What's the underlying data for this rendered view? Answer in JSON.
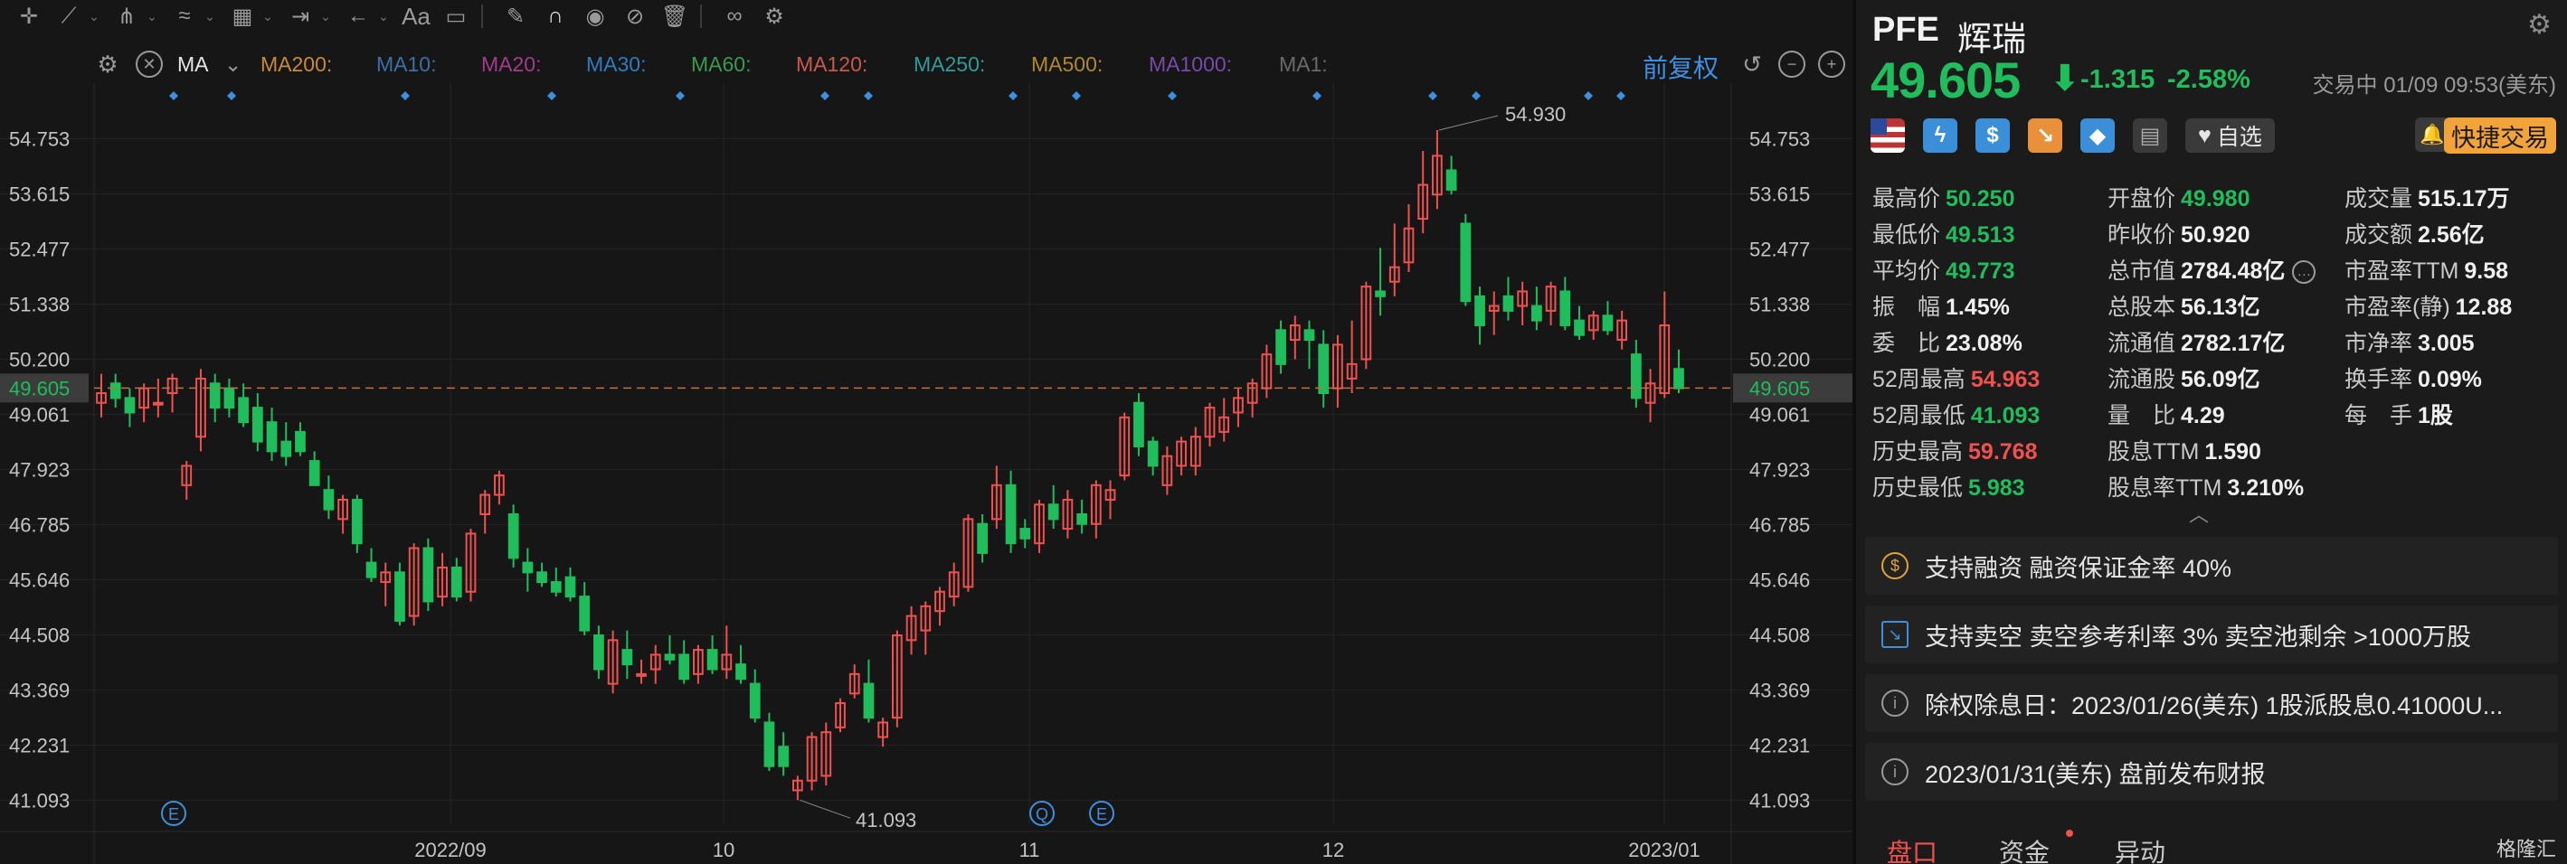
{
  "toolbar": {
    "icons": [
      "crosshair-icon",
      "line-tool-icon",
      "pitchfork-icon",
      "wave-icon",
      "fibonacci-icon",
      "measure-icon",
      "arrow-icon",
      "text-icon",
      "comment-icon",
      "pen-icon",
      "magnet-icon",
      "eye-icon",
      "hide-icon",
      "trash-icon",
      "link-icon",
      "gear-icon"
    ],
    "text_tool": "Aa"
  },
  "indicator_bar": {
    "selected": "MA",
    "items": [
      {
        "label": "MA200:",
        "color": "#c9883b"
      },
      {
        "label": "MA10:",
        "color": "#3b6fa6"
      },
      {
        "label": "MA20:",
        "color": "#a23b8c"
      },
      {
        "label": "MA30:",
        "color": "#2f7bbf"
      },
      {
        "label": "MA60:",
        "color": "#3a9a4e"
      },
      {
        "label": "MA120:",
        "color": "#c95a4a"
      },
      {
        "label": "MA250:",
        "color": "#2f9b9b"
      },
      {
        "label": "MA500:",
        "color": "#b08a2a"
      },
      {
        "label": "MA1000:",
        "color": "#7a4aa8"
      },
      {
        "label": "MA1:",
        "color": "#6a6a6a"
      }
    ],
    "adjust_label": "前复权"
  },
  "chart_data": {
    "type": "candlestick",
    "y_ticks": [
      "54.753",
      "53.615",
      "52.477",
      "51.338",
      "50.200",
      "49.061",
      "47.923",
      "46.785",
      "45.646",
      "44.508",
      "43.369",
      "42.231",
      "41.093"
    ],
    "ylim": [
      40.6,
      55.9
    ],
    "x_ticks": [
      "2022/09",
      "10",
      "11",
      "12",
      "2023/01"
    ],
    "current_price": 49.605,
    "annotations": [
      {
        "label": "54.930",
        "value": 54.93
      },
      {
        "label": "41.093",
        "value": 41.093
      }
    ],
    "event_markers": [
      "E",
      "Q",
      "E"
    ],
    "colors": {
      "up": "#f0514f",
      "down": "#1fbd5b",
      "current_line": "#c7703a",
      "current_label_bg": "#3c3c3c"
    },
    "candles": [
      [
        49.3,
        49.9,
        49.0,
        49.5
      ],
      [
        49.7,
        49.9,
        49.2,
        49.4
      ],
      [
        49.4,
        49.6,
        48.8,
        49.1
      ],
      [
        49.2,
        49.7,
        48.9,
        49.6
      ],
      [
        49.3,
        49.8,
        49.0,
        49.3
      ],
      [
        49.5,
        49.9,
        49.1,
        49.8
      ],
      [
        47.6,
        48.1,
        47.3,
        48.0
      ],
      [
        48.6,
        50.0,
        48.3,
        49.8
      ],
      [
        49.7,
        49.9,
        48.9,
        49.2
      ],
      [
        49.6,
        49.8,
        49.0,
        49.2
      ],
      [
        49.4,
        49.7,
        48.8,
        48.9
      ],
      [
        49.2,
        49.5,
        48.3,
        48.5
      ],
      [
        48.9,
        49.2,
        48.1,
        48.3
      ],
      [
        48.5,
        48.9,
        48.0,
        48.2
      ],
      [
        48.7,
        48.9,
        48.2,
        48.3
      ],
      [
        48.1,
        48.3,
        47.6,
        47.6
      ],
      [
        47.5,
        47.8,
        46.9,
        47.1
      ],
      [
        46.9,
        47.4,
        46.6,
        47.3
      ],
      [
        47.3,
        47.4,
        46.2,
        46.4
      ],
      [
        46.0,
        46.3,
        45.6,
        45.7
      ],
      [
        45.6,
        46.0,
        45.1,
        45.8
      ],
      [
        45.8,
        46.0,
        44.7,
        44.8
      ],
      [
        44.9,
        46.4,
        44.7,
        46.3
      ],
      [
        46.3,
        46.5,
        45.0,
        45.2
      ],
      [
        45.3,
        46.2,
        45.1,
        45.9
      ],
      [
        45.9,
        46.1,
        45.2,
        45.3
      ],
      [
        45.4,
        46.7,
        45.2,
        46.6
      ],
      [
        47.0,
        47.5,
        46.6,
        47.4
      ],
      [
        47.4,
        47.9,
        47.2,
        47.8
      ],
      [
        47.0,
        47.2,
        45.9,
        46.1
      ],
      [
        46.0,
        46.3,
        45.4,
        45.8
      ],
      [
        45.8,
        46.0,
        45.5,
        45.6
      ],
      [
        45.6,
        45.9,
        45.3,
        45.4
      ],
      [
        45.7,
        45.9,
        45.2,
        45.3
      ],
      [
        45.3,
        45.6,
        44.5,
        44.6
      ],
      [
        44.5,
        44.7,
        43.6,
        43.8
      ],
      [
        43.5,
        44.6,
        43.3,
        44.4
      ],
      [
        44.2,
        44.6,
        43.6,
        43.9
      ],
      [
        43.7,
        44.0,
        43.5,
        43.7
      ],
      [
        43.8,
        44.3,
        43.5,
        44.1
      ],
      [
        44.1,
        44.5,
        43.9,
        44.0
      ],
      [
        44.1,
        44.4,
        43.5,
        43.6
      ],
      [
        43.7,
        44.3,
        43.5,
        44.2
      ],
      [
        44.2,
        44.5,
        43.7,
        43.8
      ],
      [
        43.8,
        44.7,
        43.6,
        44.1
      ],
      [
        43.9,
        44.3,
        43.5,
        43.6
      ],
      [
        43.5,
        43.8,
        42.7,
        42.8
      ],
      [
        42.7,
        42.9,
        41.7,
        41.8
      ],
      [
        42.2,
        42.5,
        41.6,
        41.8
      ],
      [
        41.3,
        41.6,
        41.1,
        41.5
      ],
      [
        41.5,
        42.5,
        41.3,
        42.4
      ],
      [
        41.6,
        42.7,
        41.4,
        42.5
      ],
      [
        42.6,
        43.2,
        42.5,
        43.1
      ],
      [
        43.3,
        43.9,
        43.2,
        43.7
      ],
      [
        43.5,
        44.0,
        42.7,
        42.8
      ],
      [
        42.4,
        42.8,
        42.2,
        42.7
      ],
      [
        42.8,
        44.6,
        42.6,
        44.5
      ],
      [
        44.4,
        45.1,
        44.1,
        44.9
      ],
      [
        44.6,
        45.2,
        44.1,
        45.1
      ],
      [
        45.0,
        45.5,
        44.7,
        45.4
      ],
      [
        45.3,
        46.0,
        45.1,
        45.8
      ],
      [
        45.5,
        47.0,
        45.4,
        46.9
      ],
      [
        46.8,
        47.0,
        46.0,
        46.2
      ],
      [
        46.9,
        48.0,
        46.7,
        47.6
      ],
      [
        47.6,
        47.9,
        46.2,
        46.4
      ],
      [
        46.7,
        46.9,
        46.3,
        46.5
      ],
      [
        46.4,
        47.3,
        46.2,
        47.2
      ],
      [
        47.2,
        47.6,
        46.7,
        46.9
      ],
      [
        46.7,
        47.5,
        46.5,
        47.3
      ],
      [
        47.0,
        47.3,
        46.6,
        46.8
      ],
      [
        46.8,
        47.7,
        46.5,
        47.6
      ],
      [
        47.3,
        47.7,
        46.9,
        47.5
      ],
      [
        47.8,
        49.1,
        47.7,
        49.0
      ],
      [
        49.3,
        49.5,
        48.2,
        48.4
      ],
      [
        48.5,
        48.6,
        47.8,
        48.0
      ],
      [
        47.6,
        48.4,
        47.4,
        48.2
      ],
      [
        48.0,
        48.6,
        47.8,
        48.5
      ],
      [
        48.0,
        48.8,
        47.8,
        48.6
      ],
      [
        48.6,
        49.3,
        48.4,
        49.2
      ],
      [
        48.7,
        49.4,
        48.5,
        49.0
      ],
      [
        49.1,
        49.6,
        48.8,
        49.4
      ],
      [
        49.3,
        49.8,
        49.0,
        49.7
      ],
      [
        49.6,
        50.5,
        49.4,
        50.3
      ],
      [
        50.8,
        51.0,
        49.9,
        50.1
      ],
      [
        50.6,
        51.1,
        50.2,
        50.9
      ],
      [
        50.8,
        51.0,
        50.0,
        50.6
      ],
      [
        50.5,
        50.8,
        49.2,
        49.5
      ],
      [
        49.6,
        50.7,
        49.2,
        50.5
      ],
      [
        49.8,
        51.0,
        49.5,
        50.1
      ],
      [
        50.2,
        51.8,
        50.0,
        51.7
      ],
      [
        51.6,
        52.5,
        51.1,
        51.5
      ],
      [
        51.8,
        53.0,
        51.5,
        52.1
      ],
      [
        52.2,
        53.4,
        52.0,
        52.9
      ],
      [
        53.1,
        54.5,
        52.8,
        53.8
      ],
      [
        53.6,
        54.93,
        53.3,
        54.4
      ],
      [
        54.1,
        54.4,
        53.6,
        53.7
      ],
      [
        53.0,
        53.2,
        51.3,
        51.4
      ],
      [
        51.5,
        51.7,
        50.5,
        50.9
      ],
      [
        51.2,
        51.6,
        50.7,
        51.3
      ],
      [
        51.5,
        51.9,
        51.0,
        51.2
      ],
      [
        51.3,
        51.8,
        50.9,
        51.6
      ],
      [
        51.3,
        51.7,
        50.8,
        51.0
      ],
      [
        51.2,
        51.8,
        50.9,
        51.7
      ],
      [
        51.6,
        51.9,
        50.8,
        50.9
      ],
      [
        51.0,
        51.3,
        50.6,
        50.7
      ],
      [
        50.8,
        51.2,
        50.6,
        51.1
      ],
      [
        51.1,
        51.4,
        50.7,
        50.8
      ],
      [
        50.6,
        51.2,
        50.4,
        51.0
      ],
      [
        50.3,
        50.6,
        49.2,
        49.4
      ],
      [
        49.3,
        50.0,
        48.9,
        49.7
      ],
      [
        49.5,
        51.6,
        49.4,
        50.9
      ],
      [
        50.0,
        50.4,
        49.5,
        49.6
      ]
    ]
  },
  "quote": {
    "ticker": "PFE",
    "company": "辉瑞",
    "price": "49.605",
    "arrow": "⬇",
    "change": "-1.315",
    "change_pct": "-2.58%",
    "status": "交易中 01/09 09:53(美东)",
    "icons": [
      "us-flag-icon",
      "lightning-icon",
      "dollar-icon",
      "trend-down-icon",
      "tag-icon",
      "document-icon"
    ],
    "watch_label": "自选",
    "watch_icon": "heart-icon",
    "bell_icon": "bell-icon",
    "quick_trade": "快捷交易"
  },
  "stats": {
    "col1": [
      {
        "label": "最高价",
        "value": "50.250",
        "tone": "green"
      },
      {
        "label": "最低价",
        "value": "49.513",
        "tone": "green"
      },
      {
        "label": "平均价",
        "value": "49.773",
        "tone": "green"
      },
      {
        "label": "振　幅",
        "value": "1.45%",
        "tone": "plain"
      },
      {
        "label": "委　比",
        "value": "23.08%",
        "tone": "plain"
      },
      {
        "label": "52周最高",
        "value": "54.963",
        "tone": "red"
      },
      {
        "label": "52周最低",
        "value": "41.093",
        "tone": "green"
      },
      {
        "label": "历史最高",
        "value": "59.768",
        "tone": "red"
      },
      {
        "label": "历史最低",
        "value": "5.983",
        "tone": "green"
      }
    ],
    "col2": [
      {
        "label": "开盘价",
        "value": "49.980",
        "tone": "green"
      },
      {
        "label": "昨收价",
        "value": "50.920",
        "tone": "plain"
      },
      {
        "label": "总市值",
        "value": "2784.48亿",
        "tone": "plain"
      },
      {
        "label": "总股本",
        "value": "56.13亿",
        "tone": "plain"
      },
      {
        "label": "流通值",
        "value": "2782.17亿",
        "tone": "plain"
      },
      {
        "label": "流通股",
        "value": "56.09亿",
        "tone": "plain"
      },
      {
        "label": "量　比",
        "value": "4.29",
        "tone": "plain"
      },
      {
        "label": "股息TTM",
        "value": "1.590",
        "tone": "plain"
      },
      {
        "label": "股息率TTM",
        "value": "3.210%",
        "tone": "plain"
      }
    ],
    "col3": [
      {
        "label": "成交量",
        "value": "515.17万",
        "tone": "plain"
      },
      {
        "label": "成交额",
        "value": "2.56亿",
        "tone": "plain"
      },
      {
        "label": "市盈率TTM",
        "value": "9.58",
        "tone": "plain"
      },
      {
        "label": "市盈率(静)",
        "value": "12.88",
        "tone": "plain"
      },
      {
        "label": "市净率",
        "value": "3.005",
        "tone": "plain"
      },
      {
        "label": "换手率",
        "value": "0.09%",
        "tone": "plain"
      },
      {
        "label": "每　手",
        "value": "1股",
        "tone": "plain"
      }
    ]
  },
  "cards": [
    {
      "icon": "dollar-circle-icon",
      "text": "支持融资 融资保证金率 40%",
      "color": "#e0a23a"
    },
    {
      "icon": "short-sell-icon",
      "text": "支持卖空 卖空参考利率 3% 卖空池剩余 >1000万股",
      "color": "#3f8fd8"
    },
    {
      "icon": "info-icon",
      "text": "除权除息日：2023/01/26(美东)  1股派股息0.41000U...",
      "color": "#9a9a9a"
    },
    {
      "icon": "info-icon",
      "text": "2023/01/31(美东)  盘前发布财报",
      "color": "#9a9a9a"
    }
  ],
  "tabs": {
    "t1": "盘口",
    "t2": "资金",
    "t3": "异动"
  },
  "watermark": "格隆汇"
}
